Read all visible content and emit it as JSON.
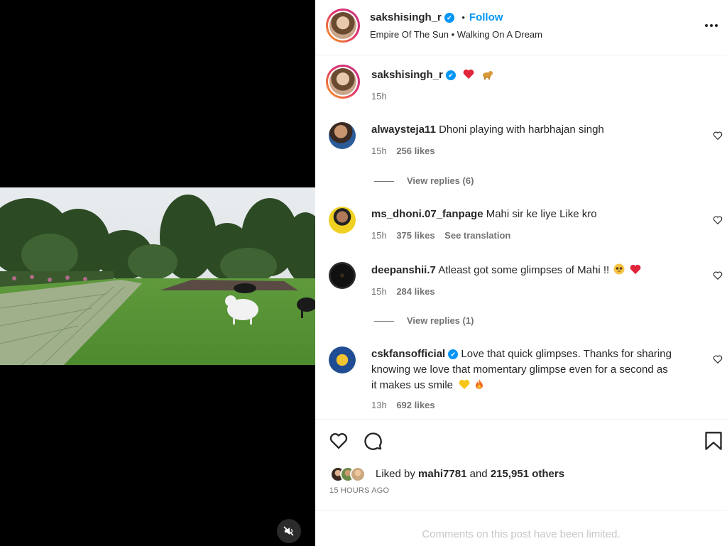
{
  "post": {
    "author": "sakshisingh_r",
    "follow_label": "Follow",
    "dot": "•",
    "audio": "Empire Of The Sun • Walking On A Dream",
    "caption_time": "15h",
    "more_icon": "more-horizontal-icon"
  },
  "comments": [
    {
      "user": "alwaysteja11",
      "text": "Dhoni playing with harbhajan singh",
      "time": "15h",
      "likes": "256 likes",
      "view_replies": "View replies (6)"
    },
    {
      "user": "ms_dhoni.07_fanpage",
      "text": "Mahi sir ke liye Like kro",
      "time": "15h",
      "likes": "375 likes",
      "translation": "See translation"
    },
    {
      "user": "deepanshii.7",
      "text": "Atleast got some glimpses of Mahi !!",
      "time": "15h",
      "likes": "284 likes",
      "view_replies": "View replies (1)"
    },
    {
      "user": "cskfansofficial",
      "text_line1": "Love that quick glimpses. Thanks for sharing",
      "text_line2": "knowing we love that momentary glimpse even for a second as",
      "text_line3": "it makes us smile",
      "time": "13h",
      "likes": "692 likes"
    }
  ],
  "actions": {
    "liked_prefix": "Liked by",
    "liked_user": "mahi7781",
    "liked_and": "and",
    "liked_others": "215,951 others",
    "timestamp": "15 HOURS AGO"
  },
  "footer": {
    "limited_text": "Comments on this post have been limited."
  },
  "colors": {
    "accent": "#0095f6",
    "text": "#262626",
    "muted": "#737373",
    "heart_red": "#ed4956"
  }
}
